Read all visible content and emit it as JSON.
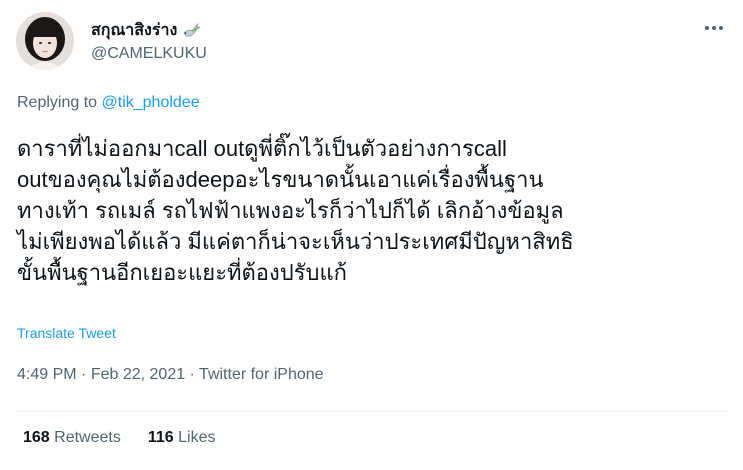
{
  "user": {
    "display_name": "สกุณาสิงร่าง",
    "handle": "@CAMELKUKU",
    "name_emoji_icon": "dove-icon"
  },
  "reply": {
    "prefix": "Replying to",
    "mention": "@tik_pholdee"
  },
  "tweet": {
    "text": "ดาราที่ไม่ออกมาcall outดูพี่ติ๊กไว้เป็นตัวอย่างการcall\noutของคุณไม่ต้องdeepอะไรขนาดนั้นเอาแค่เรื่องพื้นฐาน\nทางเท้า รถเมล์ รถไฟฟ้าแพงอะไรก็ว่าไปก็ได้ เลิกอ้างข้อมูล\nไม่เพียงพอได้แล้ว มีแค่ตาก็น่าจะเห็นว่าประเทศมีปัญหาสิทธิ\nขั้นพื้นฐานอีกเยอะแยะที่ต้องปรับแก้",
    "translate_label": "Translate Tweet"
  },
  "meta": {
    "time": "4:49 PM",
    "separator": " · ",
    "date": "Feb 22, 2021",
    "source": "Twitter for iPhone"
  },
  "stats": {
    "retweets_count": "168",
    "retweets_label": "Retweets",
    "likes_count": "116",
    "likes_label": "Likes"
  },
  "colors": {
    "accent": "#1d9bf0",
    "text": "#0f1419",
    "secondary": "#536471",
    "divider": "#eff3f4"
  }
}
